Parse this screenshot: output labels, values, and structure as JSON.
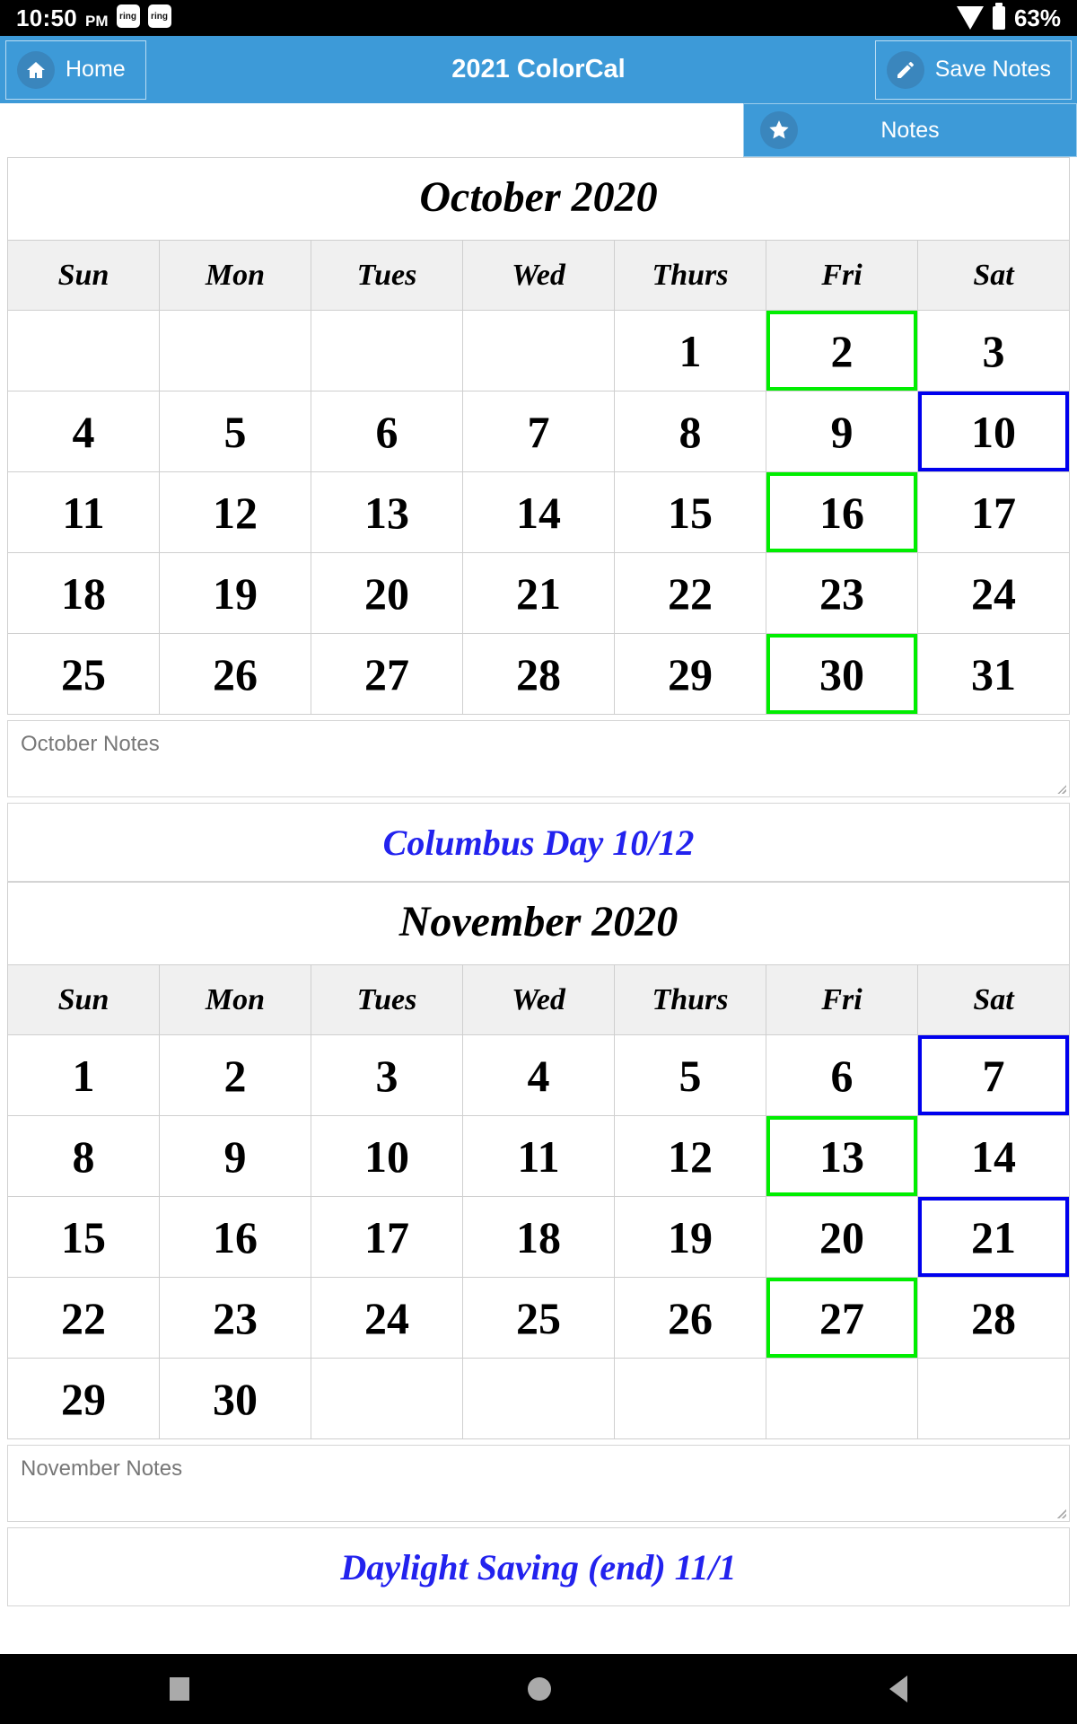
{
  "statusbar": {
    "time": "10:50",
    "ampm": "PM",
    "notif_badges": [
      "ring",
      "ring"
    ],
    "battery_pct": "63%",
    "wifi_icon": "wifi-icon",
    "battery_icon": "battery-icon"
  },
  "appbar": {
    "home_label": "Home",
    "home_icon": "home-icon",
    "title": "2021 ColorCal",
    "save_label": "Save Notes",
    "save_icon": "pencil-icon",
    "accent": "#3d9ad8"
  },
  "notes_tab": {
    "label": "Notes",
    "icon": "star-icon"
  },
  "weekdays": [
    "Sun",
    "Mon",
    "Tues",
    "Wed",
    "Thurs",
    "Fri",
    "Sat"
  ],
  "months": [
    {
      "title": "October 2020",
      "notes_placeholder": "October Notes",
      "notes_value": "",
      "holiday": "Columbus Day 10/12",
      "weeks": [
        [
          {
            "day": "",
            "bg": "white",
            "fg": "black",
            "sel": ""
          },
          {
            "day": "",
            "bg": "white",
            "fg": "black",
            "sel": ""
          },
          {
            "day": "",
            "bg": "white",
            "fg": "black",
            "sel": ""
          },
          {
            "day": "",
            "bg": "white",
            "fg": "black",
            "sel": ""
          },
          {
            "day": "1",
            "bg": "brown",
            "fg": "black",
            "sel": ""
          },
          {
            "day": "2",
            "bg": "red",
            "fg": "green",
            "sel": "green"
          },
          {
            "day": "3",
            "bg": "red",
            "fg": "black",
            "sel": ""
          }
        ],
        [
          {
            "day": "4",
            "bg": "white",
            "fg": "black",
            "sel": ""
          },
          {
            "day": "5",
            "bg": "black",
            "fg": "white",
            "sel": ""
          },
          {
            "day": "6",
            "bg": "yellow",
            "fg": "black",
            "sel": ""
          },
          {
            "day": "7",
            "bg": "blue",
            "fg": "white",
            "sel": ""
          },
          {
            "day": "8",
            "bg": "green",
            "fg": "black",
            "sel": ""
          },
          {
            "day": "9",
            "bg": "brown",
            "fg": "black",
            "sel": ""
          },
          {
            "day": "10",
            "bg": "brown",
            "fg": "black",
            "sel": "blue"
          }
        ],
        [
          {
            "day": "11",
            "bg": "white",
            "fg": "black",
            "sel": ""
          },
          {
            "day": "12",
            "bg": "glow-red",
            "fg": "red",
            "sel": ""
          },
          {
            "day": "13",
            "bg": "black",
            "fg": "white",
            "sel": ""
          },
          {
            "day": "14",
            "bg": "yellow",
            "fg": "black",
            "sel": ""
          },
          {
            "day": "15",
            "bg": "blue",
            "fg": "white",
            "sel": ""
          },
          {
            "day": "16",
            "bg": "green",
            "fg": "green",
            "sel": "green"
          },
          {
            "day": "17",
            "bg": "green",
            "fg": "black",
            "sel": ""
          }
        ],
        [
          {
            "day": "18",
            "bg": "white",
            "fg": "black",
            "sel": ""
          },
          {
            "day": "19",
            "bg": "brown",
            "fg": "black",
            "sel": ""
          },
          {
            "day": "20",
            "bg": "red",
            "fg": "black",
            "sel": ""
          },
          {
            "day": "21",
            "bg": "black",
            "fg": "white",
            "sel": ""
          },
          {
            "day": "22",
            "bg": "yellow",
            "fg": "black",
            "sel": ""
          },
          {
            "day": "23",
            "bg": "blue",
            "fg": "white",
            "sel": ""
          },
          {
            "day": "24",
            "bg": "blue",
            "fg": "white",
            "sel": ""
          }
        ],
        [
          {
            "day": "25",
            "bg": "white",
            "fg": "black",
            "sel": ""
          },
          {
            "day": "26",
            "bg": "green",
            "fg": "black",
            "sel": ""
          },
          {
            "day": "27",
            "bg": "brown",
            "fg": "black",
            "sel": ""
          },
          {
            "day": "28",
            "bg": "red",
            "fg": "black",
            "sel": ""
          },
          {
            "day": "29",
            "bg": "black",
            "fg": "white",
            "sel": ""
          },
          {
            "day": "30",
            "bg": "yellow",
            "fg": "green",
            "sel": "green"
          },
          {
            "day": "31",
            "bg": "yellow",
            "fg": "black",
            "sel": ""
          }
        ]
      ]
    },
    {
      "title": "November 2020",
      "notes_placeholder": "November Notes",
      "notes_value": "",
      "holiday": "Daylight Saving (end) 11/1",
      "weeks": [
        [
          {
            "day": "1",
            "bg": "white",
            "fg": "black",
            "sel": ""
          },
          {
            "day": "2",
            "bg": "blue",
            "fg": "white",
            "sel": ""
          },
          {
            "day": "3",
            "bg": "green",
            "fg": "black",
            "sel": ""
          },
          {
            "day": "4",
            "bg": "brown",
            "fg": "black",
            "sel": ""
          },
          {
            "day": "5",
            "bg": "red",
            "fg": "black",
            "sel": ""
          },
          {
            "day": "6",
            "bg": "black",
            "fg": "white",
            "sel": ""
          },
          {
            "day": "7",
            "bg": "black",
            "fg": "white",
            "sel": "blue"
          }
        ],
        [
          {
            "day": "8",
            "bg": "white",
            "fg": "black",
            "sel": ""
          },
          {
            "day": "9",
            "bg": "yellow",
            "fg": "black",
            "sel": ""
          },
          {
            "day": "10",
            "bg": "blue",
            "fg": "white",
            "sel": ""
          },
          {
            "day": "11",
            "bg": "glow-green",
            "fg": "red",
            "sel": ""
          },
          {
            "day": "12",
            "bg": "brown",
            "fg": "black",
            "sel": ""
          },
          {
            "day": "13",
            "bg": "red",
            "fg": "green",
            "sel": "green"
          },
          {
            "day": "14",
            "bg": "red",
            "fg": "black",
            "sel": ""
          }
        ],
        [
          {
            "day": "15",
            "bg": "white",
            "fg": "black",
            "sel": ""
          },
          {
            "day": "16",
            "bg": "black",
            "fg": "white",
            "sel": ""
          },
          {
            "day": "17",
            "bg": "yellow",
            "fg": "black",
            "sel": ""
          },
          {
            "day": "18",
            "bg": "blue",
            "fg": "white",
            "sel": ""
          },
          {
            "day": "19",
            "bg": "green",
            "fg": "black",
            "sel": ""
          },
          {
            "day": "20",
            "bg": "brown",
            "fg": "black",
            "sel": ""
          },
          {
            "day": "21",
            "bg": "brown",
            "fg": "black",
            "sel": "blue"
          }
        ],
        [
          {
            "day": "22",
            "bg": "white",
            "fg": "black",
            "sel": ""
          },
          {
            "day": "23",
            "bg": "red",
            "fg": "black",
            "sel": ""
          },
          {
            "day": "24",
            "bg": "black",
            "fg": "white",
            "sel": ""
          },
          {
            "day": "25",
            "bg": "yellow",
            "fg": "black",
            "sel": ""
          },
          {
            "day": "26",
            "bg": "glow-blue",
            "fg": "red",
            "sel": ""
          },
          {
            "day": "27",
            "bg": "green",
            "fg": "green",
            "sel": "green"
          },
          {
            "day": "28",
            "bg": "green",
            "fg": "black",
            "sel": ""
          }
        ],
        [
          {
            "day": "29",
            "bg": "white",
            "fg": "black",
            "sel": ""
          },
          {
            "day": "30",
            "bg": "brown",
            "fg": "black",
            "sel": ""
          },
          {
            "day": "",
            "bg": "white",
            "fg": "black",
            "sel": ""
          },
          {
            "day": "",
            "bg": "white",
            "fg": "black",
            "sel": ""
          },
          {
            "day": "",
            "bg": "white",
            "fg": "black",
            "sel": ""
          },
          {
            "day": "",
            "bg": "white",
            "fg": "black",
            "sel": ""
          },
          {
            "day": "",
            "bg": "white",
            "fg": "black",
            "sel": ""
          }
        ]
      ]
    }
  ],
  "navbar": {
    "recents_icon": "square-recents-icon",
    "home_icon": "circle-home-icon",
    "back_icon": "triangle-back-icon"
  }
}
